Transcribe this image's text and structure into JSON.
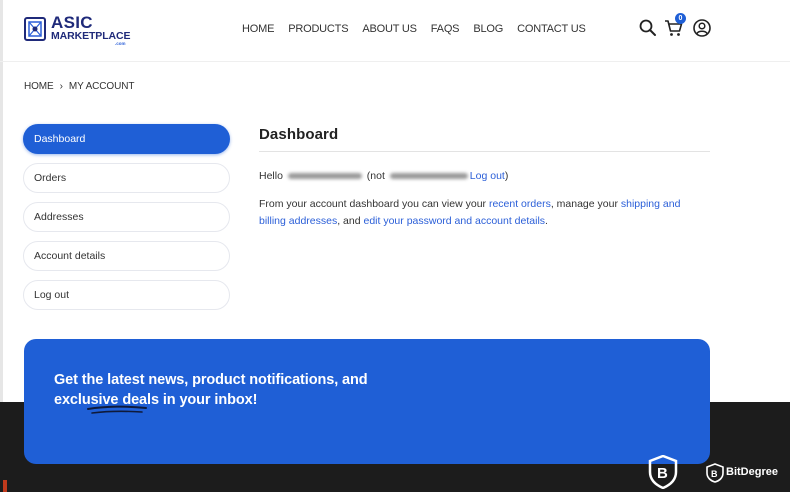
{
  "brand": {
    "line1": "ASIC",
    "line2": "MARKETPLACE",
    "line3": ".com",
    "color": "#1f2a7a"
  },
  "nav": {
    "items": [
      "HOME",
      "PRODUCTS",
      "ABOUT US",
      "FAQS",
      "BLOG",
      "CONTACT US"
    ]
  },
  "header_icons": {
    "search": "search-icon",
    "cart": "cart-icon",
    "cart_count": "0",
    "account": "user-icon"
  },
  "breadcrumb": {
    "home": "HOME",
    "separator": "›",
    "current": "MY ACCOUNT"
  },
  "sidebar": {
    "items": [
      {
        "label": "Dashboard",
        "active": true
      },
      {
        "label": "Orders",
        "active": false
      },
      {
        "label": "Addresses",
        "active": false
      },
      {
        "label": "Account details",
        "active": false
      },
      {
        "label": "Log out",
        "active": false
      }
    ]
  },
  "main": {
    "title": "Dashboard",
    "hello_prefix": "Hello",
    "not_open": "(not",
    "logout_link": "Log out",
    "close_paren": ")",
    "intro_1": "From your account dashboard you can view your ",
    "recent_orders": "recent orders",
    "intro_2": ", manage your ",
    "addresses_link": "shipping and billing addresses",
    "intro_3": ", and ",
    "password_link": "edit your password and account details",
    "intro_4": "."
  },
  "newsletter": {
    "line1": "Get the latest news, product notifications, and",
    "line2": "exclusive deals in your inbox!"
  },
  "watermark": {
    "text": "BitDegree"
  },
  "colors": {
    "accent": "#1f5fd6",
    "link": "#2b5fd8",
    "footer": "#1c1c1c"
  }
}
